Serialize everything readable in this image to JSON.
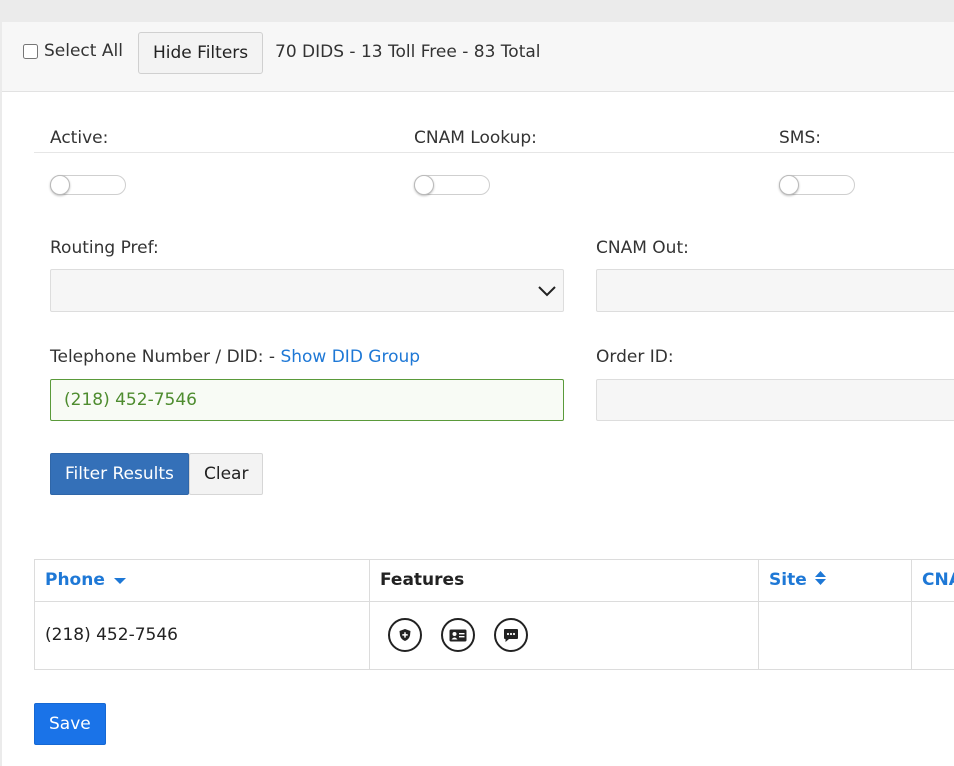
{
  "toolbar": {
    "select_all_label": "Select All",
    "hide_filters_label": "Hide Filters",
    "counts_text": "70 DIDS - 13 Toll Free - 83 Total"
  },
  "filters": {
    "active_label": "Active:",
    "cnam_lookup_label": "CNAM Lookup:",
    "sms_label": "SMS:",
    "routing_pref_label": "Routing Pref:",
    "routing_pref_value": "",
    "cnam_out_label": "CNAM Out:",
    "cnam_out_value": "",
    "telephone_label": "Telephone Number / DID: - ",
    "show_did_group_link": "Show DID Group",
    "telephone_value": "(218) 452-7546",
    "order_id_label": "Order ID:",
    "order_id_value": "",
    "filter_button": "Filter Results",
    "clear_button": "Clear"
  },
  "table": {
    "headers": {
      "phone": "Phone",
      "features": "Features",
      "site": "Site",
      "cnam": "CNAM"
    },
    "rows": [
      {
        "phone": "(218) 452-7546",
        "features": [
          "shield-icon",
          "id-card-icon",
          "chat-icon"
        ],
        "site": "",
        "cnam": ""
      }
    ]
  },
  "footer": {
    "save_button": "Save"
  },
  "colors": {
    "link": "#1e78d6",
    "filter_button": "#3470b8",
    "save_button": "#1a73e8",
    "valid_field": "#4e8c2f"
  }
}
